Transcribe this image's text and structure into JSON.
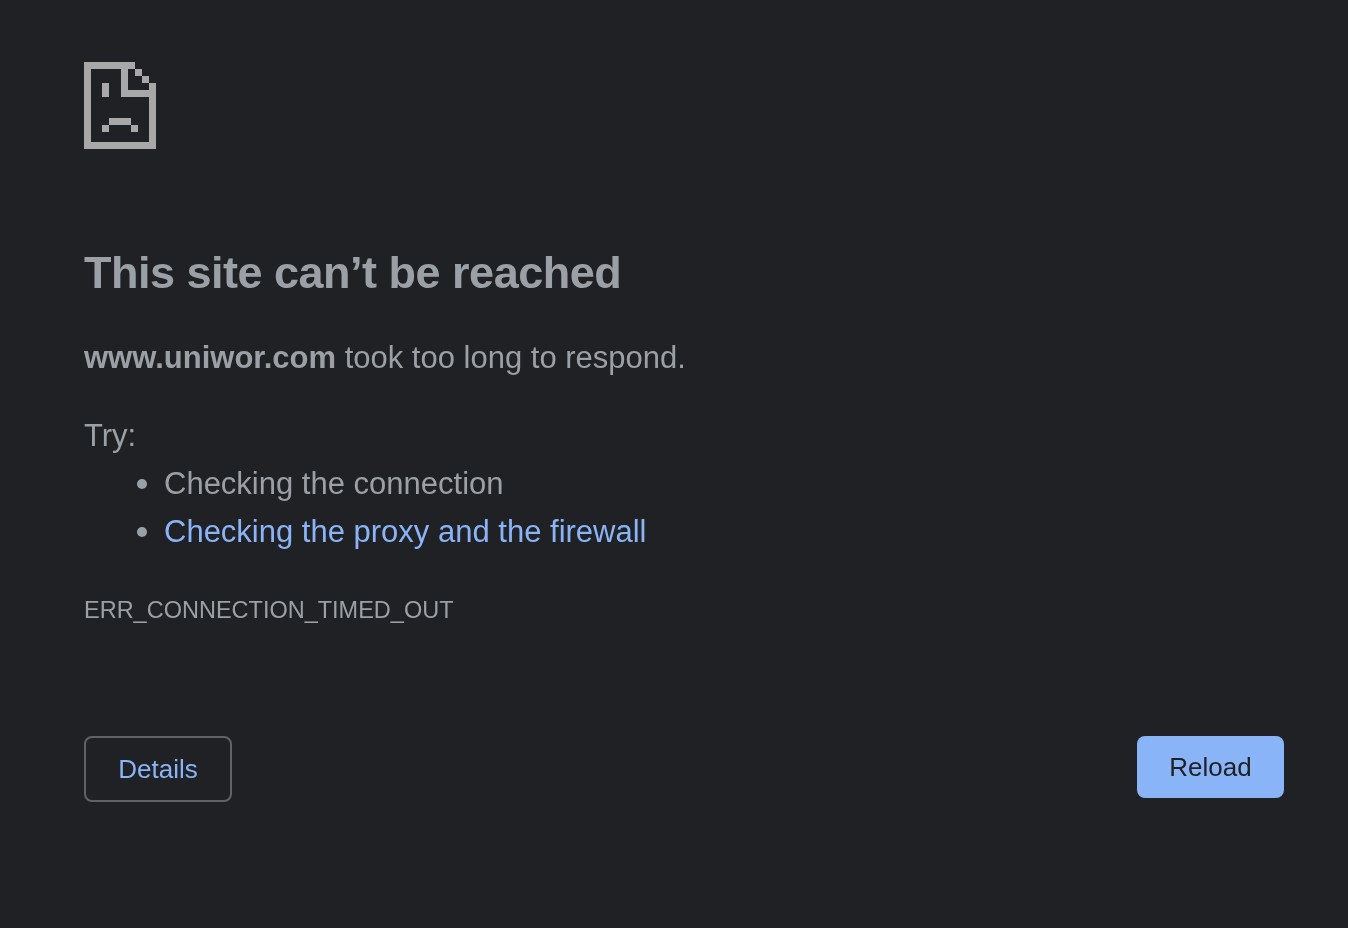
{
  "heading": "This site can’t be reached",
  "message": "**www.uniwor.com** took too long to respond.",
  "suggestions": {
    "label": "Try:",
    "items": [
      {
        "text": "Checking the connection",
        "kind": "text"
      },
      {
        "text": "Checking the proxy and the firewall",
        "kind": "link"
      }
    ]
  },
  "error_code": "ERR_CONNECTION_TIMED_OUT",
  "buttons": [
    {
      "label": "Details",
      "kind": "secondary"
    },
    {
      "label": "Reload",
      "kind": "primary"
    }
  ]
}
